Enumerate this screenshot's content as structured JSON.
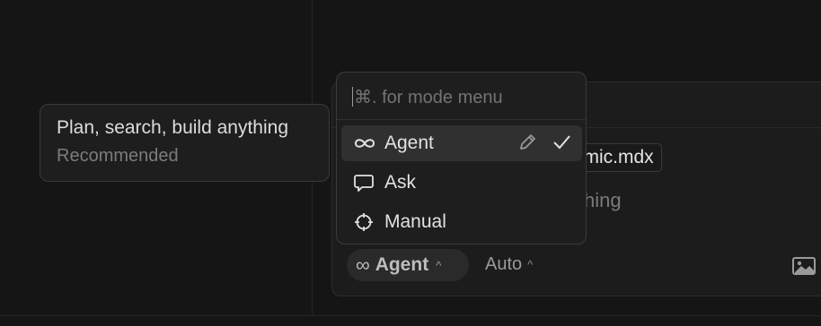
{
  "tooltip": {
    "title": "Plan, search, build anything",
    "subtitle": "Recommended"
  },
  "mode_menu": {
    "hint": "⌘. for mode menu",
    "items": [
      {
        "label": "Agent",
        "icon": "infinity-icon",
        "selected": true
      },
      {
        "label": "Ask",
        "icon": "chat-bubble-icon",
        "selected": false
      },
      {
        "label": "Manual",
        "icon": "crosshair-icon",
        "selected": false
      }
    ]
  },
  "composer": {
    "file_chip": "smic.mdx",
    "placeholder_fragment": "hing"
  },
  "controls": {
    "mode_button": "Agent",
    "model_button": "Auto"
  },
  "colors": {
    "background": "#151515",
    "panel": "#1e1e1e",
    "selected_row": "#303030"
  }
}
